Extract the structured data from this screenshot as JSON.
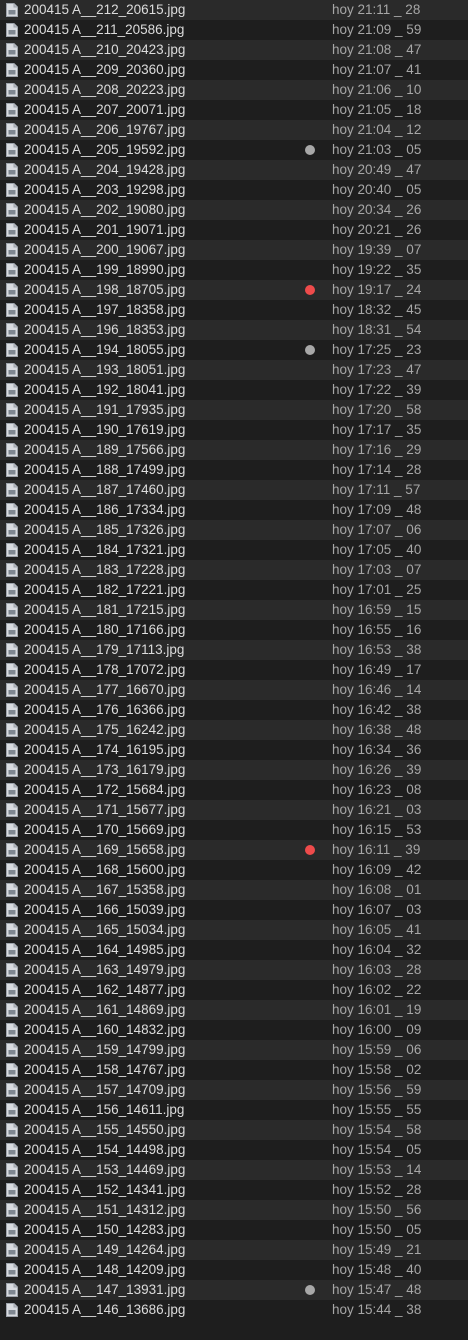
{
  "files": [
    {
      "name": "200415 A__212_20615.jpg",
      "date": "hoy 21:11 _ 28",
      "tag": null
    },
    {
      "name": "200415 A__211_20586.jpg",
      "date": "hoy 21:09 _ 59",
      "tag": null
    },
    {
      "name": "200415 A__210_20423.jpg",
      "date": "hoy 21:08 _ 47",
      "tag": null
    },
    {
      "name": "200415 A__209_20360.jpg",
      "date": "hoy 21:07 _ 41",
      "tag": null
    },
    {
      "name": "200415 A__208_20223.jpg",
      "date": "hoy 21:06 _ 10",
      "tag": null
    },
    {
      "name": "200415 A__207_20071.jpg",
      "date": "hoy 21:05 _ 18",
      "tag": null
    },
    {
      "name": "200415 A__206_19767.jpg",
      "date": "hoy 21:04 _ 12",
      "tag": null
    },
    {
      "name": "200415 A__205_19592.jpg",
      "date": "hoy 21:03 _ 05",
      "tag": "gray"
    },
    {
      "name": "200415 A__204_19428.jpg",
      "date": "hoy 20:49 _ 47",
      "tag": null
    },
    {
      "name": "200415 A__203_19298.jpg",
      "date": "hoy 20:40 _ 05",
      "tag": null
    },
    {
      "name": "200415 A__202_19080.jpg",
      "date": "hoy 20:34 _ 26",
      "tag": null
    },
    {
      "name": "200415 A__201_19071.jpg",
      "date": "hoy 20:21 _ 26",
      "tag": null
    },
    {
      "name": "200415 A__200_19067.jpg",
      "date": "hoy 19:39 _ 07",
      "tag": null
    },
    {
      "name": "200415 A__199_18990.jpg",
      "date": "hoy 19:22 _ 35",
      "tag": null
    },
    {
      "name": "200415 A__198_18705.jpg",
      "date": "hoy 19:17 _ 24",
      "tag": "red"
    },
    {
      "name": "200415 A__197_18358.jpg",
      "date": "hoy 18:32 _ 45",
      "tag": null
    },
    {
      "name": "200415 A__196_18353.jpg",
      "date": "hoy 18:31 _ 54",
      "tag": null
    },
    {
      "name": "200415 A__194_18055.jpg",
      "date": "hoy 17:25 _ 23",
      "tag": "gray"
    },
    {
      "name": "200415 A__193_18051.jpg",
      "date": "hoy 17:23 _ 47",
      "tag": null
    },
    {
      "name": "200415 A__192_18041.jpg",
      "date": "hoy 17:22 _ 39",
      "tag": null
    },
    {
      "name": "200415 A__191_17935.jpg",
      "date": "hoy 17:20 _ 58",
      "tag": null
    },
    {
      "name": "200415 A__190_17619.jpg",
      "date": "hoy 17:17 _ 35",
      "tag": null
    },
    {
      "name": "200415 A__189_17566.jpg",
      "date": "hoy 17:16 _ 29",
      "tag": null
    },
    {
      "name": "200415 A__188_17499.jpg",
      "date": "hoy 17:14 _ 28",
      "tag": null
    },
    {
      "name": "200415 A__187_17460.jpg",
      "date": "hoy 17:11 _ 57",
      "tag": null
    },
    {
      "name": "200415 A__186_17334.jpg",
      "date": "hoy 17:09 _ 48",
      "tag": null
    },
    {
      "name": "200415 A__185_17326.jpg",
      "date": "hoy 17:07 _ 06",
      "tag": null
    },
    {
      "name": "200415 A__184_17321.jpg",
      "date": "hoy 17:05 _ 40",
      "tag": null
    },
    {
      "name": "200415 A__183_17228.jpg",
      "date": "hoy 17:03 _ 07",
      "tag": null
    },
    {
      "name": "200415 A__182_17221.jpg",
      "date": "hoy 17:01 _ 25",
      "tag": null
    },
    {
      "name": "200415 A__181_17215.jpg",
      "date": "hoy 16:59 _ 15",
      "tag": null
    },
    {
      "name": "200415 A__180_17166.jpg",
      "date": "hoy 16:55 _ 16",
      "tag": null
    },
    {
      "name": "200415 A__179_17113.jpg",
      "date": "hoy 16:53 _ 38",
      "tag": null
    },
    {
      "name": "200415 A__178_17072.jpg",
      "date": "hoy 16:49 _ 17",
      "tag": null
    },
    {
      "name": "200415 A__177_16670.jpg",
      "date": "hoy 16:46 _ 14",
      "tag": null
    },
    {
      "name": "200415 A__176_16366.jpg",
      "date": "hoy 16:42 _ 38",
      "tag": null
    },
    {
      "name": "200415 A__175_16242.jpg",
      "date": "hoy 16:38 _ 48",
      "tag": null
    },
    {
      "name": "200415 A__174_16195.jpg",
      "date": "hoy 16:34 _ 36",
      "tag": null
    },
    {
      "name": "200415 A__173_16179.jpg",
      "date": "hoy 16:26 _ 39",
      "tag": null
    },
    {
      "name": "200415 A__172_15684.jpg",
      "date": "hoy 16:23 _ 08",
      "tag": null
    },
    {
      "name": "200415 A__171_15677.jpg",
      "date": "hoy 16:21 _ 03",
      "tag": null
    },
    {
      "name": "200415 A__170_15669.jpg",
      "date": "hoy 16:15 _ 53",
      "tag": null
    },
    {
      "name": "200415 A__169_15658.jpg",
      "date": "hoy 16:11 _ 39",
      "tag": "red"
    },
    {
      "name": "200415 A__168_15600.jpg",
      "date": "hoy 16:09 _ 42",
      "tag": null
    },
    {
      "name": "200415 A__167_15358.jpg",
      "date": "hoy 16:08 _ 01",
      "tag": null
    },
    {
      "name": "200415 A__166_15039.jpg",
      "date": "hoy 16:07 _ 03",
      "tag": null
    },
    {
      "name": "200415 A__165_15034.jpg",
      "date": "hoy 16:05 _ 41",
      "tag": null
    },
    {
      "name": "200415 A__164_14985.jpg",
      "date": "hoy 16:04 _ 32",
      "tag": null
    },
    {
      "name": "200415 A__163_14979.jpg",
      "date": "hoy 16:03 _ 28",
      "tag": null
    },
    {
      "name": "200415 A__162_14877.jpg",
      "date": "hoy 16:02 _ 22",
      "tag": null
    },
    {
      "name": "200415 A__161_14869.jpg",
      "date": "hoy 16:01 _ 19",
      "tag": null
    },
    {
      "name": "200415 A__160_14832.jpg",
      "date": "hoy 16:00 _ 09",
      "tag": null
    },
    {
      "name": "200415 A__159_14799.jpg",
      "date": "hoy 15:59 _ 06",
      "tag": null
    },
    {
      "name": "200415 A__158_14767.jpg",
      "date": "hoy 15:58 _ 02",
      "tag": null
    },
    {
      "name": "200415 A__157_14709.jpg",
      "date": "hoy 15:56 _ 59",
      "tag": null
    },
    {
      "name": "200415 A__156_14611.jpg",
      "date": "hoy 15:55 _ 55",
      "tag": null
    },
    {
      "name": "200415 A__155_14550.jpg",
      "date": "hoy 15:54 _ 58",
      "tag": null
    },
    {
      "name": "200415 A__154_14498.jpg",
      "date": "hoy 15:54 _ 05",
      "tag": null
    },
    {
      "name": "200415 A__153_14469.jpg",
      "date": "hoy 15:53 _ 14",
      "tag": null
    },
    {
      "name": "200415 A__152_14341.jpg",
      "date": "hoy 15:52 _ 28",
      "tag": null
    },
    {
      "name": "200415 A__151_14312.jpg",
      "date": "hoy 15:50 _ 56",
      "tag": null
    },
    {
      "name": "200415 A__150_14283.jpg",
      "date": "hoy 15:50 _ 05",
      "tag": null
    },
    {
      "name": "200415 A__149_14264.jpg",
      "date": "hoy 15:49 _ 21",
      "tag": null
    },
    {
      "name": "200415 A__148_14209.jpg",
      "date": "hoy 15:48 _ 40",
      "tag": null
    },
    {
      "name": "200415 A__147_13931.jpg",
      "date": "hoy 15:47 _ 48",
      "tag": "gray"
    },
    {
      "name": "200415 A__146_13686.jpg",
      "date": "hoy 15:44 _ 38",
      "tag": null
    }
  ],
  "colors": {
    "background": "#1e1e1e",
    "row_alt": "#2a2a2a",
    "name_text": "#dcdcdc",
    "date_text": "#a7a7a7",
    "tag_red": "#ee4b4b",
    "tag_gray": "#a8a8a8"
  },
  "icons": {
    "file": "document-icon"
  }
}
